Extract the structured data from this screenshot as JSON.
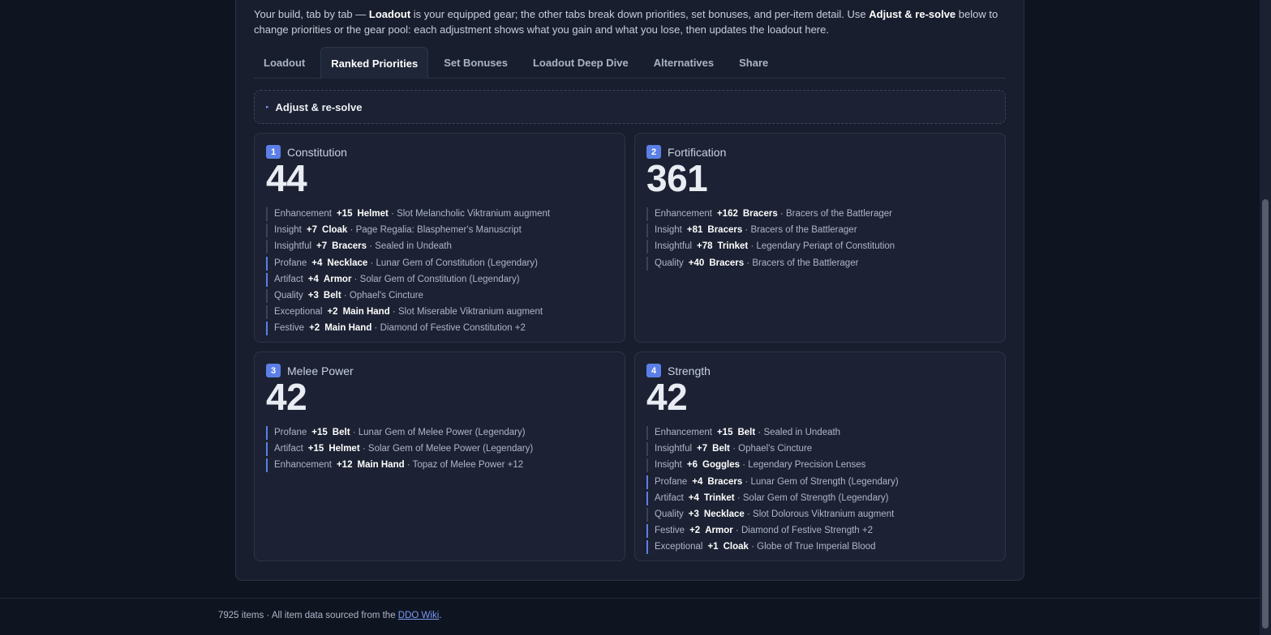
{
  "intro": {
    "p1": "Your build, tab by tab — ",
    "b1": "Loadout",
    "p2": " is your equipped gear; the other tabs break down priorities, set bonuses, and per-item detail. Use ",
    "b2": "Adjust & re-solve",
    "p3": " below to change priorities or the gear pool: each adjustment shows what you gain and what you lose, then updates the loadout here."
  },
  "tabs": [
    {
      "label": "Loadout",
      "active": false
    },
    {
      "label": "Ranked Priorities",
      "active": true
    },
    {
      "label": "Set Bonuses",
      "active": false
    },
    {
      "label": "Loadout Deep Dive",
      "active": false
    },
    {
      "label": "Alternatives",
      "active": false
    },
    {
      "label": "Share",
      "active": false
    }
  ],
  "adjust": {
    "label": "Adjust & re-solve",
    "caret": "▸"
  },
  "cards": [
    {
      "rank": "1",
      "name": "Constitution",
      "total": "44",
      "rows": [
        {
          "type": "Enhancement",
          "value": "+15",
          "slot": "Helmet",
          "source": "Slot Melancholic Viktranium augment",
          "highlight": false
        },
        {
          "type": "Insight",
          "value": "+7",
          "slot": "Cloak",
          "source": "Page Regalia: Blasphemer's Manuscript",
          "highlight": false
        },
        {
          "type": "Insightful",
          "value": "+7",
          "slot": "Bracers",
          "source": "Sealed in Undeath",
          "highlight": false
        },
        {
          "type": "Profane",
          "value": "+4",
          "slot": "Necklace",
          "source": "Lunar Gem of Constitution (Legendary)",
          "highlight": true
        },
        {
          "type": "Artifact",
          "value": "+4",
          "slot": "Armor",
          "source": "Solar Gem of Constitution (Legendary)",
          "highlight": true
        },
        {
          "type": "Quality",
          "value": "+3",
          "slot": "Belt",
          "source": "Ophael's Cincture",
          "highlight": false
        },
        {
          "type": "Exceptional",
          "value": "+2",
          "slot": "Main Hand",
          "source": "Slot Miserable Viktranium augment",
          "highlight": false
        },
        {
          "type": "Festive",
          "value": "+2",
          "slot": "Main Hand",
          "source": "Diamond of Festive Constitution +2",
          "highlight": true
        }
      ]
    },
    {
      "rank": "2",
      "name": "Fortification",
      "total": "361",
      "rows": [
        {
          "type": "Enhancement",
          "value": "+162",
          "slot": "Bracers",
          "source": "Bracers of the Battlerager",
          "highlight": false
        },
        {
          "type": "Insight",
          "value": "+81",
          "slot": "Bracers",
          "source": "Bracers of the Battlerager",
          "highlight": false
        },
        {
          "type": "Insightful",
          "value": "+78",
          "slot": "Trinket",
          "source": "Legendary Periapt of Constitution",
          "highlight": false
        },
        {
          "type": "Quality",
          "value": "+40",
          "slot": "Bracers",
          "source": "Bracers of the Battlerager",
          "highlight": false
        }
      ]
    },
    {
      "rank": "3",
      "name": "Melee Power",
      "total": "42",
      "rows": [
        {
          "type": "Profane",
          "value": "+15",
          "slot": "Belt",
          "source": "Lunar Gem of Melee Power (Legendary)",
          "highlight": true
        },
        {
          "type": "Artifact",
          "value": "+15",
          "slot": "Helmet",
          "source": "Solar Gem of Melee Power (Legendary)",
          "highlight": true
        },
        {
          "type": "Enhancement",
          "value": "+12",
          "slot": "Main Hand",
          "source": "Topaz of Melee Power +12",
          "highlight": true
        }
      ]
    },
    {
      "rank": "4",
      "name": "Strength",
      "total": "42",
      "rows": [
        {
          "type": "Enhancement",
          "value": "+15",
          "slot": "Belt",
          "source": "Sealed in Undeath",
          "highlight": false
        },
        {
          "type": "Insightful",
          "value": "+7",
          "slot": "Belt",
          "source": "Ophael's Cincture",
          "highlight": false
        },
        {
          "type": "Insight",
          "value": "+6",
          "slot": "Goggles",
          "source": "Legendary Precision Lenses",
          "highlight": false
        },
        {
          "type": "Profane",
          "value": "+4",
          "slot": "Bracers",
          "source": "Lunar Gem of Strength (Legendary)",
          "highlight": true
        },
        {
          "type": "Artifact",
          "value": "+4",
          "slot": "Trinket",
          "source": "Solar Gem of Strength (Legendary)",
          "highlight": true
        },
        {
          "type": "Quality",
          "value": "+3",
          "slot": "Necklace",
          "source": "Slot Dolorous Viktranium augment",
          "highlight": false
        },
        {
          "type": "Festive",
          "value": "+2",
          "slot": "Armor",
          "source": "Diamond of Festive Strength +2",
          "highlight": true
        },
        {
          "type": "Exceptional",
          "value": "+1",
          "slot": "Cloak",
          "source": "Globe of True Imperial Blood",
          "highlight": true
        }
      ]
    }
  ],
  "footer": {
    "text": "7925 items · All item data sourced from the ",
    "link": "DDO Wiki",
    "end": "."
  },
  "colors": {
    "accent": "#5b7fe6",
    "background": "#0f1421",
    "card": "#1c2233"
  }
}
